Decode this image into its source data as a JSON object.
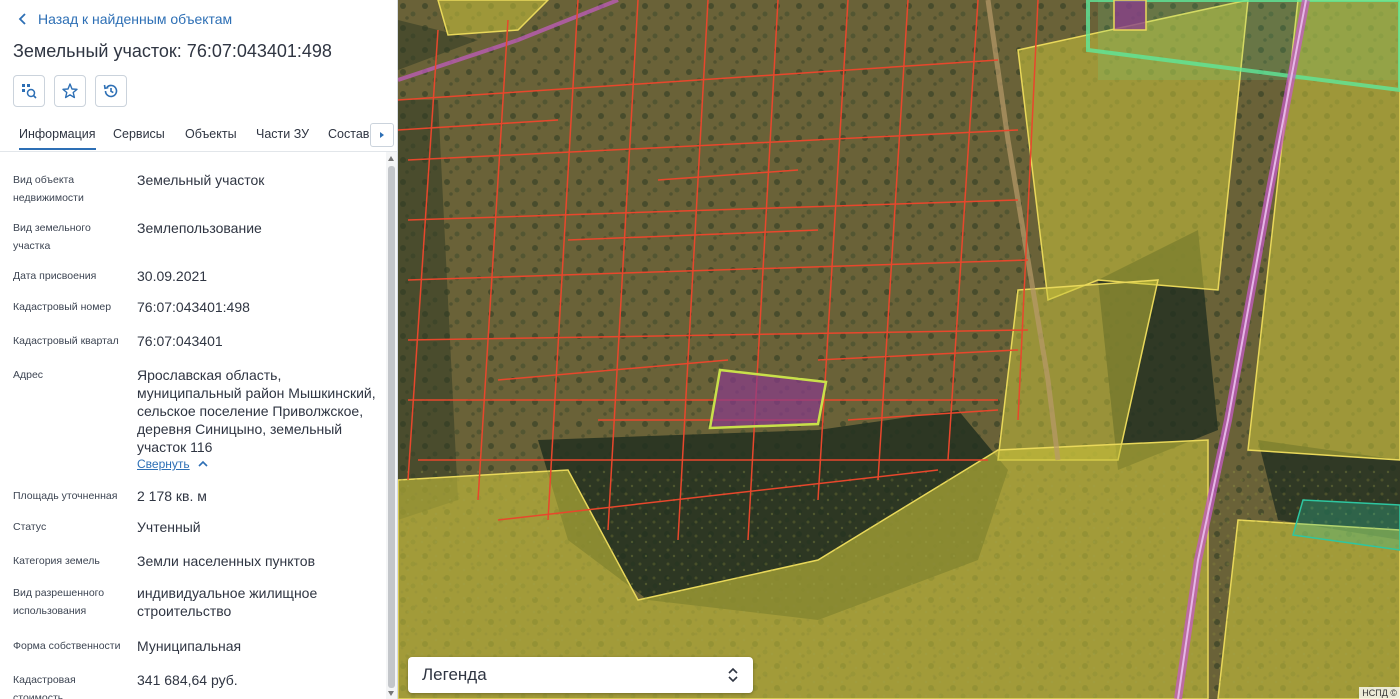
{
  "panel": {
    "back_label": "Назад к найденным объектам",
    "title": "Земельный участок: 76:07:043401:498",
    "tabs": [
      "Информация",
      "Сервисы",
      "Объекты",
      "Части ЗУ",
      "Состав"
    ],
    "active_tab": "Информация",
    "rows": [
      {
        "label": "Вид объекта недвижимости",
        "value": "Земельный участок"
      },
      {
        "label": "Вид земельного участка",
        "value": "Землепользование"
      },
      {
        "label": "Дата присвоения",
        "value": "30.09.2021"
      },
      {
        "label": "Кадастровый номер",
        "value": "76:07:043401:498"
      },
      {
        "label": "Кадастровый квартал",
        "value": "76:07:043401"
      },
      {
        "label": "Адрес",
        "value": "Ярославская область, муниципальный район Мышкинский, сельское поселение Приволжское, деревня Синицыно, земельный участок 116"
      },
      {
        "label": "Площадь уточненная",
        "value": "2 178 кв. м"
      },
      {
        "label": "Статус",
        "value": "Учтенный"
      },
      {
        "label": "Категория земель",
        "value": "Земли населенных пунктов"
      },
      {
        "label": "Вид разрешенного использования",
        "value": "индивидуальное жилищное строительство"
      },
      {
        "label": "Форма собственности",
        "value": "Муниципальная"
      },
      {
        "label": "Кадастровая стоимость",
        "value": "341 684,64 руб."
      }
    ],
    "collapse_label": "Свернуть"
  },
  "map": {
    "legend_label": "Легенда",
    "attribution": "НСПД ©",
    "colors": {
      "parcel_border": "#e8472c",
      "selected_fill": "#8a3a8c",
      "selected_border": "#c9e04a",
      "zone_fill": "#c8c23a",
      "zone_border": "#e9d85a",
      "green_zone": "#5fe89a",
      "teal_zone": "#2ec6a0",
      "road": "#c65bc6"
    }
  }
}
